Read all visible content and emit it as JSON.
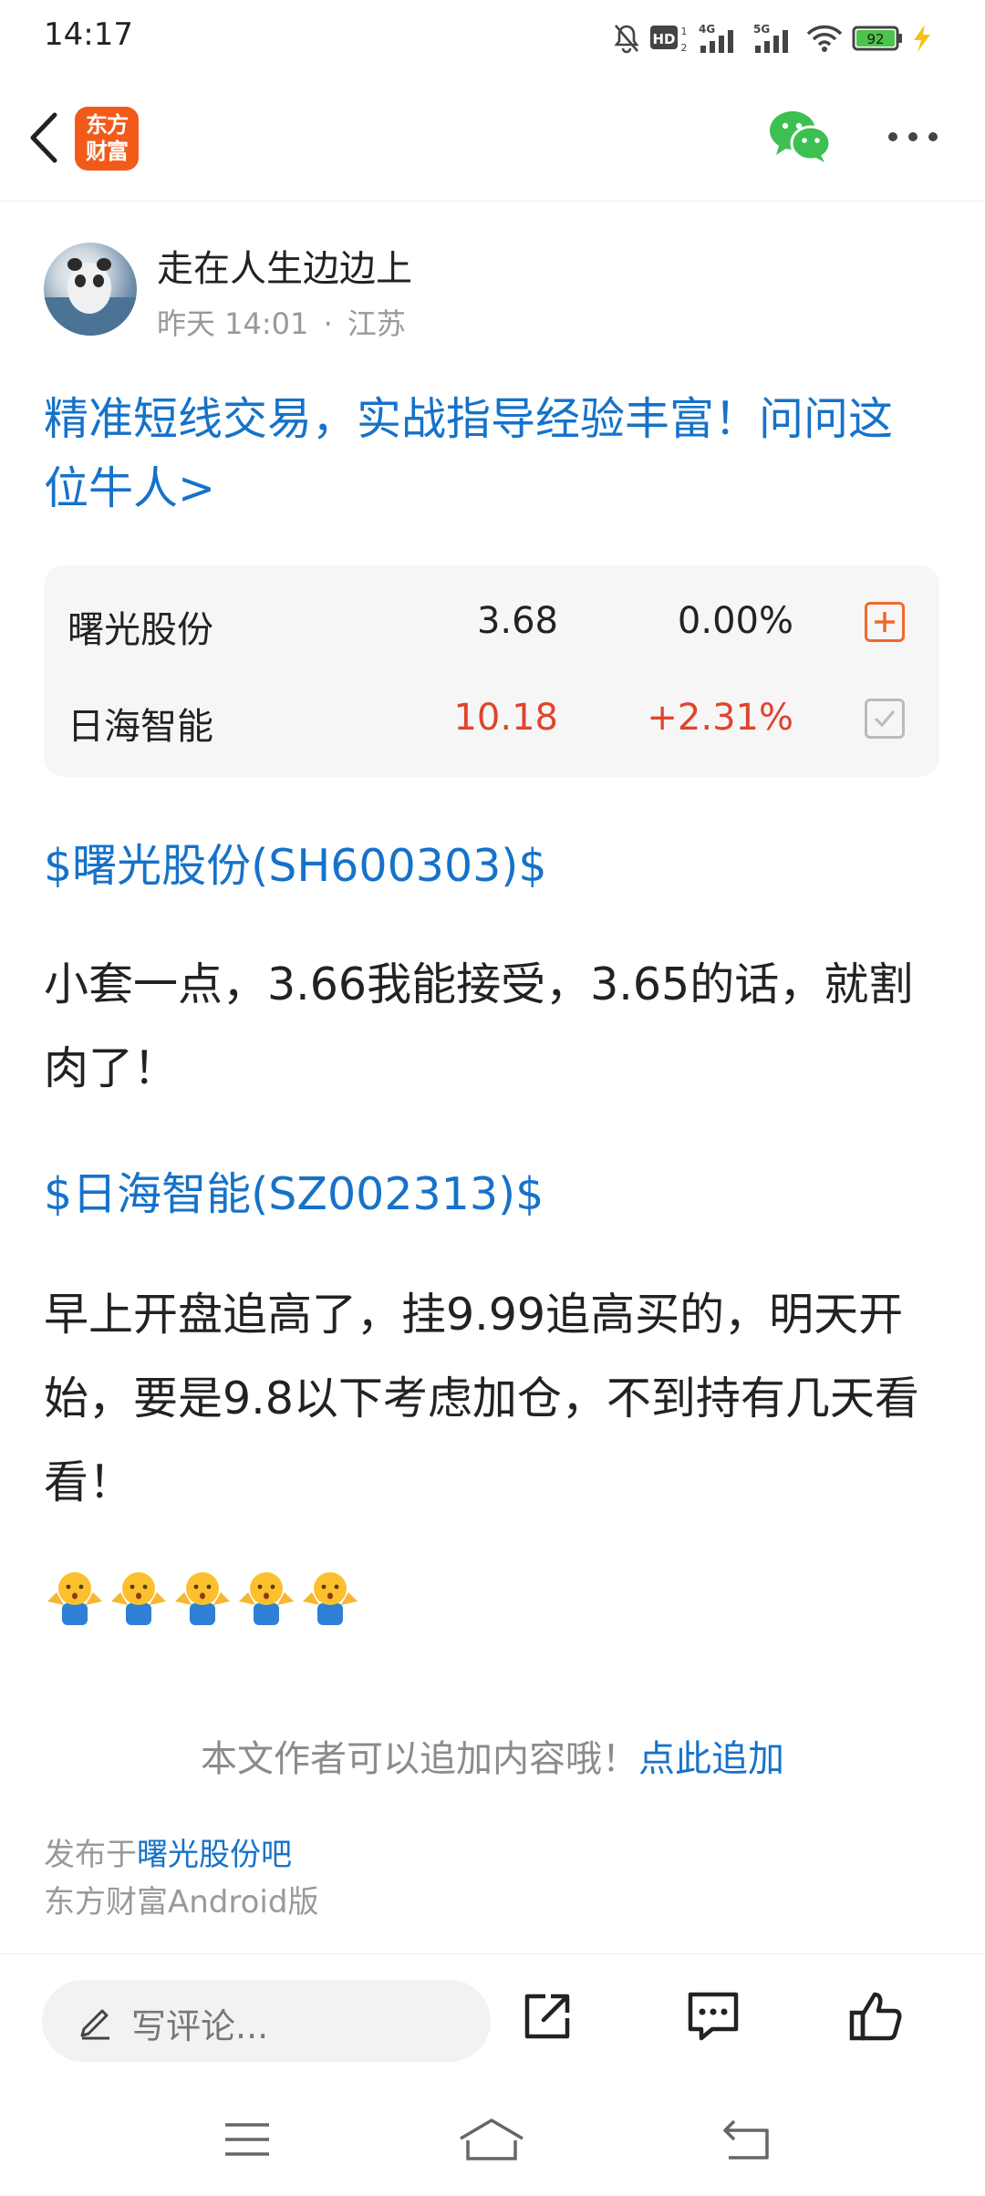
{
  "status_bar": {
    "time": "14:17",
    "icons": [
      "bell-off-icon",
      "hd-icon",
      "signal-4g-icon",
      "signal-5g-icon",
      "wifi-icon",
      "battery-icon",
      "charging-icon"
    ],
    "battery_level": "92"
  },
  "nav": {
    "back_icon": "chevron-left-icon",
    "logo_line1": "东方",
    "logo_line2": "财富",
    "share_icon": "wechat-icon",
    "more_icon": "more-dots-icon"
  },
  "author": {
    "name": "走在人生边边上",
    "time": "昨天 14:01",
    "separator": "·",
    "location": "江苏"
  },
  "promo_text": "精准短线交易，实战指导经验丰富！问问这位牛人>",
  "stocks": [
    {
      "name": "曙光股份",
      "price": "3.68",
      "change": "0.00%",
      "color": "#222222",
      "action": "add-icon"
    },
    {
      "name": "日海智能",
      "price": "10.18",
      "change": "+2.31%",
      "color": "#e0442c",
      "action": "checked-icon"
    }
  ],
  "post": {
    "tag1": "$曙光股份(SH600303)$",
    "para1": "小套一点，3.66我能接受，3.65的话，就割肉了！",
    "tag2": "$日海智能(SZ002313)$",
    "para2": "早上开盘追高了，挂9.99追高买的，明天开始，要是9.8以下考虑加仓，不到持有几天看看！",
    "emoji_name": "shrug-emoji"
  },
  "append": {
    "notice": "本文作者可以追加内容哦！",
    "link": "点此追加"
  },
  "footer": {
    "posted_prefix": "发布于",
    "posted_bar": "曙光股份吧",
    "client": "东方财富Android版"
  },
  "bottom_bar": {
    "comment_placeholder": "写评论...",
    "icons": [
      "share-icon",
      "comment-icon",
      "like-icon"
    ]
  },
  "system_nav": {
    "icons": [
      "menu-icon",
      "home-icon",
      "back-icon"
    ]
  },
  "colors": {
    "link_blue": "#1672c9",
    "brand_orange": "#f25a1a",
    "up_red": "#e0442c"
  }
}
